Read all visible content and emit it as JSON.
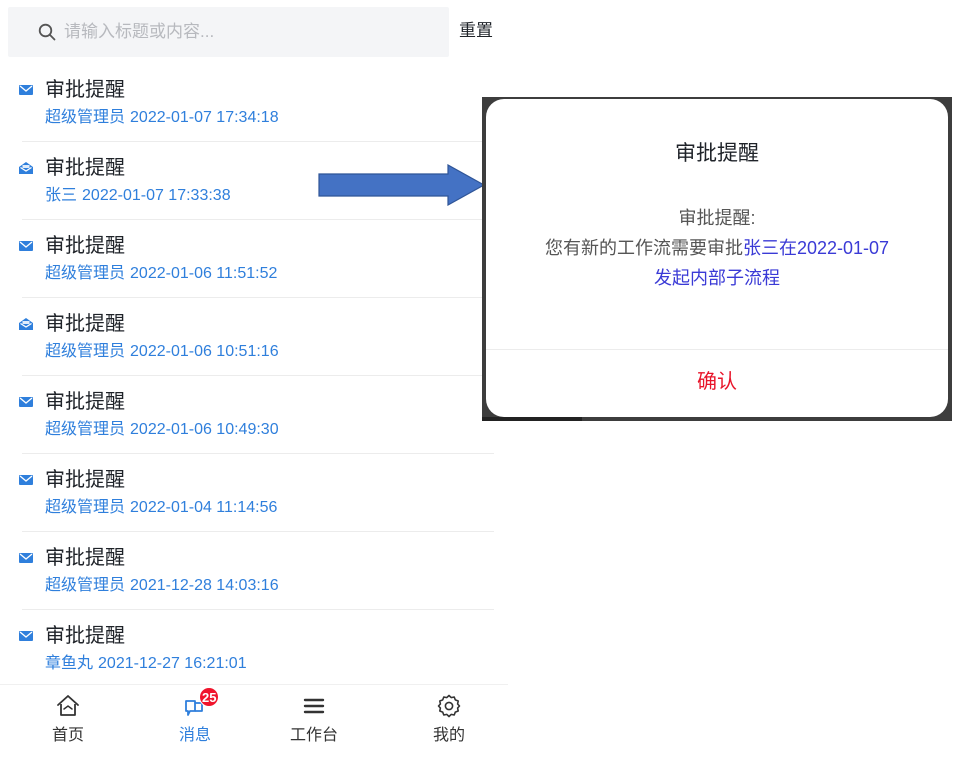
{
  "search": {
    "placeholder": "请输入标题或内容...",
    "reset_label": "重置"
  },
  "messages": [
    {
      "title": "审批提醒",
      "sender": "超级管理员",
      "time": "2022-01-07 17:34:18",
      "icon": "envelope-closed-icon"
    },
    {
      "title": "审批提醒",
      "sender": "张三",
      "time": "2022-01-07 17:33:38",
      "icon": "envelope-open-icon"
    },
    {
      "title": "审批提醒",
      "sender": "超级管理员",
      "time": "2022-01-06 11:51:52",
      "icon": "envelope-closed-icon"
    },
    {
      "title": "审批提醒",
      "sender": "超级管理员",
      "time": "2022-01-06 10:51:16",
      "icon": "envelope-open-icon"
    },
    {
      "title": "审批提醒",
      "sender": "超级管理员",
      "time": "2022-01-06 10:49:30",
      "icon": "envelope-closed-icon"
    },
    {
      "title": "审批提醒",
      "sender": "超级管理员",
      "time": "2022-01-04 11:14:56",
      "icon": "envelope-closed-icon"
    },
    {
      "title": "审批提醒",
      "sender": "超级管理员",
      "time": "2021-12-28 14:03:16",
      "icon": "envelope-closed-icon"
    },
    {
      "title": "审批提醒",
      "sender": "章鱼丸",
      "time": "2021-12-27 16:21:01",
      "icon": "envelope-closed-icon"
    }
  ],
  "tabbar": {
    "tabs": [
      {
        "label": "首页",
        "icon": "home-icon"
      },
      {
        "label": "消息",
        "icon": "message-icon",
        "badge": "25",
        "active": true
      },
      {
        "label": "工作台",
        "icon": "menu-icon"
      },
      {
        "label": "我的",
        "icon": "gear-icon"
      }
    ]
  },
  "dialog": {
    "title": "审批提醒",
    "line1": "审批提醒:",
    "line2_prefix": "您有新的工作流需要审批",
    "line2_highlight": "张三在2022-01-07",
    "line3_highlight": "发起内部子流程",
    "confirm_label": "确认"
  },
  "colors": {
    "accent_blue": "#2f7fdc",
    "badge_red": "#f0142c",
    "confirm_red": "#e8152a",
    "arrow_fill": "#4472c4",
    "highlight_text": "#3a3ad6"
  }
}
